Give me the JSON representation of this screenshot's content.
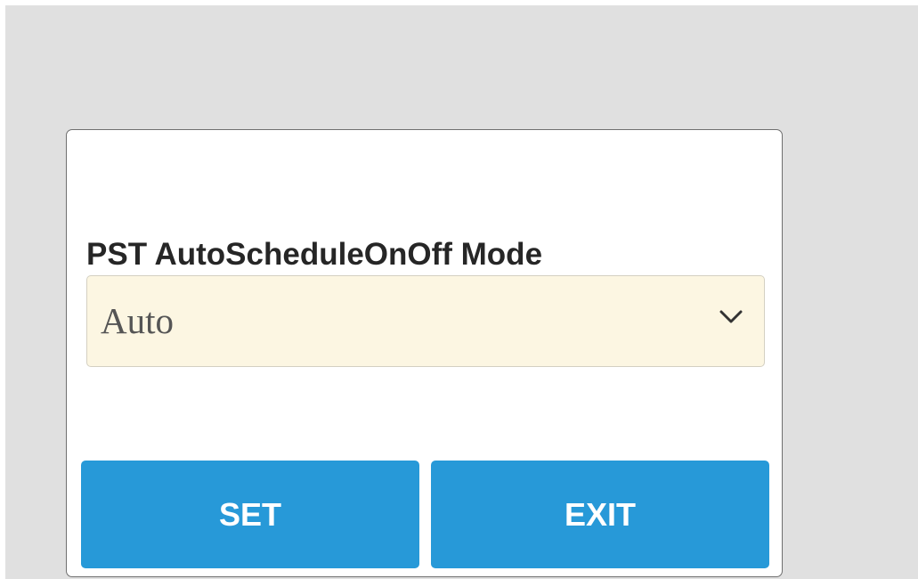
{
  "dialog": {
    "field_label": "PST AutoScheduleOnOff Mode",
    "mode_select": {
      "selected_value": "Auto",
      "icon": "chevron-down-icon"
    },
    "buttons": {
      "set_label": "SET",
      "exit_label": "EXIT"
    }
  },
  "colors": {
    "backdrop": "#e0e0e0",
    "dialog_background": "#ffffff",
    "select_background": "#fcf6e2",
    "button_background": "#2799d8",
    "button_text": "#ffffff",
    "label_text": "#262626"
  }
}
